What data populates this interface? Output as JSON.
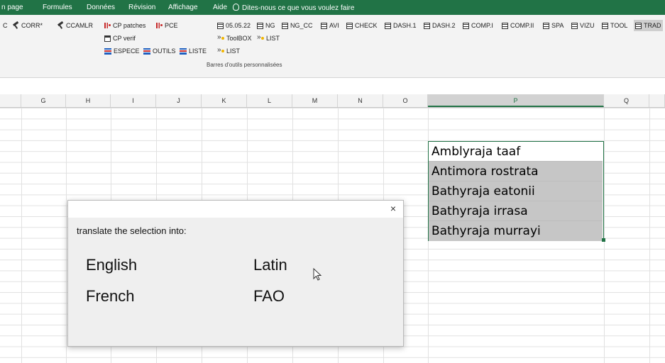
{
  "menu": {
    "items": [
      "n page",
      "Formules",
      "Données",
      "Révision",
      "Affichage",
      "Aide"
    ],
    "tell_me": "Dites-nous ce que vous voulez faire"
  },
  "ribbon": {
    "left_tools": [
      {
        "label": "C",
        "icon": "none"
      },
      {
        "label": "CORR*",
        "icon": "tool-icon"
      },
      {
        "label": "CCAMLR",
        "icon": "tool-icon"
      }
    ],
    "group1": {
      "row1": [
        {
          "label": "CP patches",
          "icon": "bars-icon"
        },
        {
          "label": "PCE",
          "icon": "bars-icon"
        }
      ],
      "row2": [
        {
          "label": "CP verif",
          "icon": "doc-icon"
        }
      ],
      "row3": [
        {
          "label": "ESPECE",
          "icon": "list-icon"
        },
        {
          "label": "OUTILS",
          "icon": "list-icon"
        },
        {
          "label": "LISTE",
          "icon": "list-icon"
        }
      ]
    },
    "group2": {
      "row1": [
        {
          "label": "05.05.22",
          "icon": "grid-icon"
        },
        {
          "label": "NG",
          "icon": "grid-icon"
        },
        {
          "label": "NG_CC",
          "icon": "grid-icon"
        },
        {
          "label": "AVI",
          "icon": "grid-icon"
        },
        {
          "label": "CHECK",
          "icon": "grid-icon"
        },
        {
          "label": "DASH.1",
          "icon": "grid-icon"
        },
        {
          "label": "DASH.2",
          "icon": "grid-icon"
        },
        {
          "label": "COMP.I",
          "icon": "grid-icon"
        },
        {
          "label": "COMP.II",
          "icon": "grid-icon"
        },
        {
          "label": "SPA",
          "icon": "grid-icon"
        },
        {
          "label": "VIZU",
          "icon": "grid-icon"
        },
        {
          "label": "TOOL",
          "icon": "grid-icon"
        },
        {
          "label": "TRAD",
          "icon": "grid-icon"
        }
      ],
      "row2": [
        {
          "label": "ToolBOX",
          "icon": "toolbox-icon"
        },
        {
          "label": "LIST",
          "icon": "toolbox-icon"
        }
      ],
      "row3": [
        {
          "label": "LIST",
          "icon": "toolbox-icon"
        }
      ]
    },
    "group_label": "Barres d'outils personnalisées"
  },
  "columns": [
    "G",
    "H",
    "I",
    "J",
    "K",
    "L",
    "M",
    "N",
    "O",
    "P",
    "Q"
  ],
  "selected_column": "P",
  "selection_cells": [
    "Amblyraja taaf",
    "Antimora rostrata",
    "Bathyraja eatonii",
    "Bathyraja irrasa",
    "Bathyraja murrayi"
  ],
  "dialog": {
    "close_glyph": "×",
    "prompt": "translate the selection into:",
    "options": [
      "English",
      "Latin",
      "French",
      "FAO"
    ]
  },
  "colors": {
    "menu_green": "#217346",
    "selection_border": "#217346",
    "selected_fill": "#c6c6c6"
  }
}
